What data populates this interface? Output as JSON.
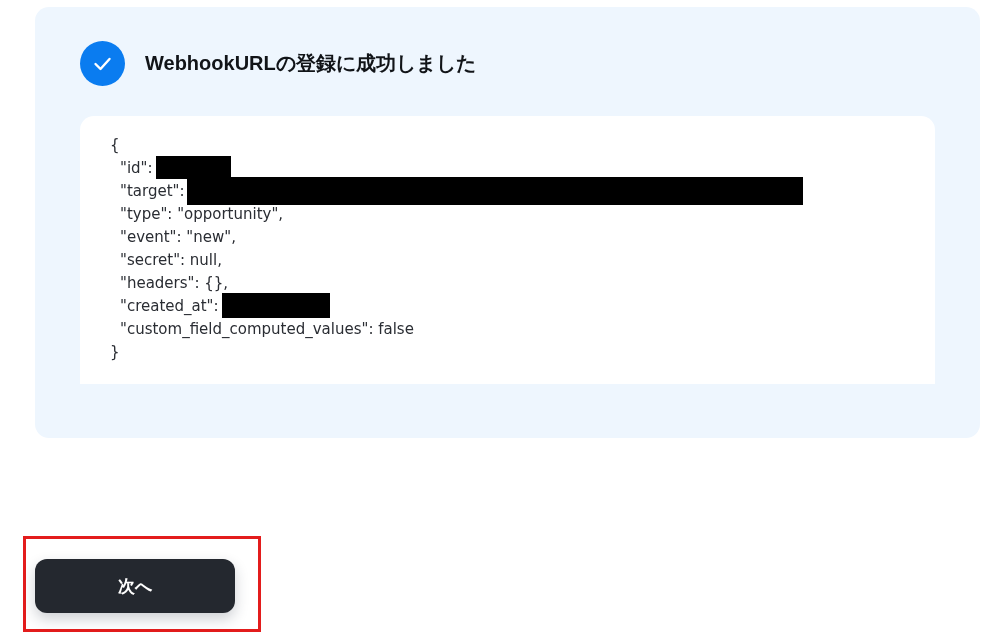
{
  "result_panel": {
    "success": true,
    "title": "WebhookURLの登録に成功しました",
    "response_lines": [
      {
        "kind": "brace",
        "text": "{",
        "redacted": false
      },
      {
        "kind": "entry",
        "text": "\"id\":",
        "redacted": true
      },
      {
        "kind": "entry",
        "text": "\"target\":",
        "redacted": true
      },
      {
        "kind": "entry",
        "text": "\"type\": \"opportunity\",",
        "redacted": false
      },
      {
        "kind": "entry",
        "text": "\"event\": \"new\",",
        "redacted": false
      },
      {
        "kind": "entry",
        "text": "\"secret\": null,",
        "redacted": false
      },
      {
        "kind": "entry",
        "text": "\"headers\": {},",
        "redacted": false
      },
      {
        "kind": "entry",
        "text": "\"created_at\":",
        "redacted": true
      },
      {
        "kind": "entry",
        "text": "\"custom_field_computed_values\": false",
        "redacted": false
      },
      {
        "kind": "brace",
        "text": "}",
        "redacted": false
      }
    ]
  },
  "next_button": {
    "label": "次へ",
    "highlighted": true
  }
}
